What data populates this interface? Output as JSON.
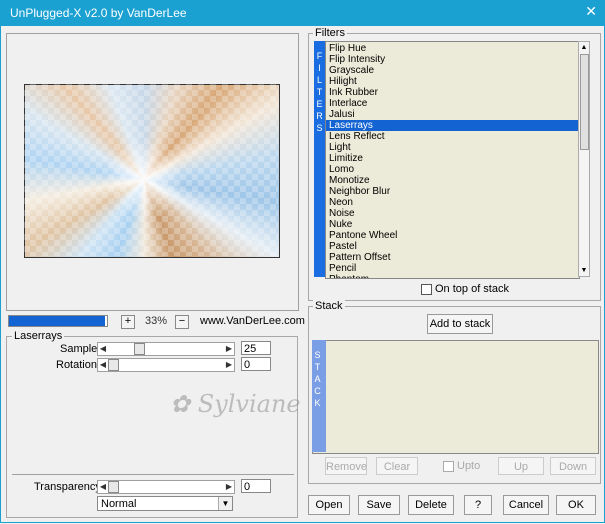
{
  "window": {
    "title": "UnPlugged-X v2.0 by VanDerLee",
    "close_glyph": "✕"
  },
  "preview": {
    "zoom": "33%",
    "site": "www.VanDerLee.com",
    "progress_fraction": 0.98,
    "zoom_in": "+",
    "zoom_out": "−"
  },
  "params": {
    "group_label": "Laserrays",
    "sample": {
      "label": "Sample",
      "value": "25",
      "position_fraction": 0.25
    },
    "rotation": {
      "label": "Rotation",
      "value": "0",
      "position_fraction": 0.0
    },
    "transparency": {
      "label": "Transparency",
      "value": "0",
      "position_fraction": 0.0
    },
    "blend_mode": "Normal"
  },
  "filters": {
    "label": "Filters",
    "side_letters": [
      "F",
      "I",
      "L",
      "T",
      "E",
      "R",
      "S"
    ],
    "items": [
      "Flip Hue",
      "Flip Intensity",
      "Grayscale",
      "Hilight",
      "Ink Rubber",
      "Interlace",
      "Jalusi",
      "Laserrays",
      "Lens Reflect",
      "Light",
      "Limitize",
      "Lomo",
      "Monotize",
      "Neighbor Blur",
      "Neon",
      "Noise",
      "Nuke",
      "Pantone Wheel",
      "Pastel",
      "Pattern Offset",
      "Pencil",
      "Phantom"
    ],
    "selected": "Laserrays",
    "on_top_label": "On top of stack"
  },
  "stack": {
    "label": "Stack",
    "add_label": "Add to stack",
    "side_letters": [
      "S",
      "T",
      "A",
      "C",
      "K"
    ],
    "remove": "Remove",
    "clear": "Clear",
    "upto": "Upto",
    "up": "Up",
    "down": "Down"
  },
  "buttons": {
    "open": "Open",
    "save": "Save",
    "delete": "Delete",
    "help": "?",
    "cancel": "Cancel",
    "ok": "OK"
  },
  "watermark": "Sylviane",
  "colors": {
    "titlebar": "#1aa1d2",
    "selection": "#1463d2",
    "list_bg": "#ecead8"
  }
}
